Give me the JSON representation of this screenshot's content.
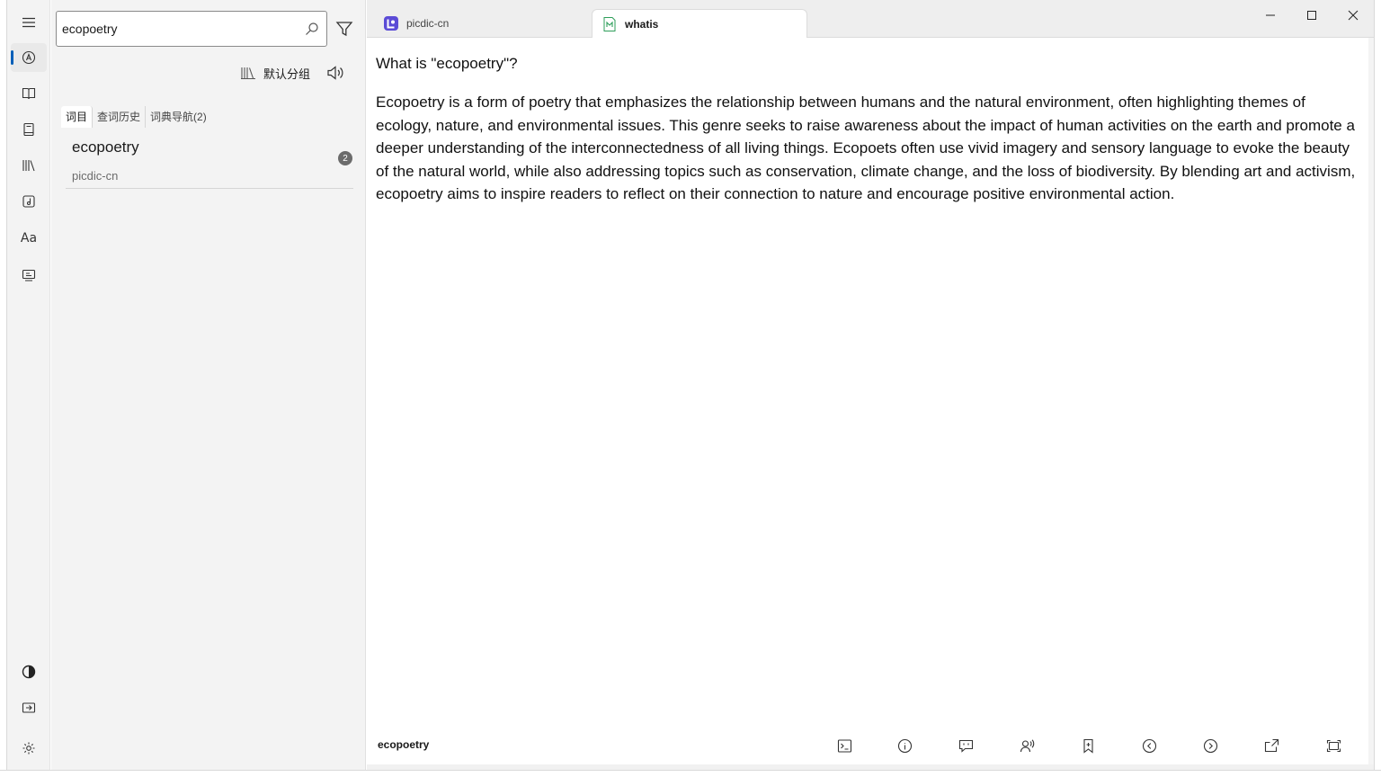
{
  "search": {
    "query": "ecopoetry"
  },
  "group": {
    "label": "默认分组"
  },
  "panel_tabs": [
    "词目",
    "查词历史",
    "词典导航(2)"
  ],
  "results": [
    {
      "word": "ecopoetry",
      "dict": "picdic-cn",
      "count": "2"
    }
  ],
  "tabs": [
    {
      "label": "picdic-cn"
    },
    {
      "label": "whatis"
    }
  ],
  "content": {
    "title": "What is \"ecopoetry\"?",
    "body": "Ecopoetry is a form of poetry that emphasizes the relationship between humans and the natural environment, often highlighting themes of ecology, nature, and environmental issues. This genre seeks to raise awareness about the impact of human activities on the earth and promote a deeper understanding of the interconnectedness of all living things. Ecopoets often use vivid imagery and sensory language to evoke the beauty of the natural world, while also addressing topics such as conservation, climate change, and the loss of biodiversity. By blending art and activism, ecopoetry aims to inspire readers to reflect on their connection to nature and encourage positive environmental action."
  },
  "bottom_bar": {
    "word": "ecopoetry"
  },
  "colors": {
    "accent": "#005fb8",
    "panel_bg": "#f3f3f3",
    "tab_icon_purple": "#5b4bd6",
    "tab_icon_green": "#2e9e5a"
  }
}
